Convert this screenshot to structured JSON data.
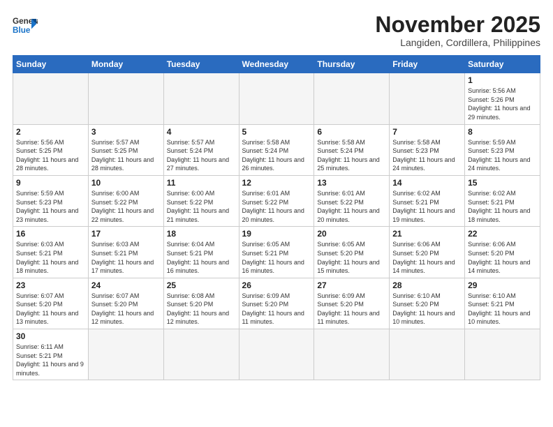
{
  "header": {
    "logo_line1": "General",
    "logo_line2": "Blue",
    "month_title": "November 2025",
    "subtitle": "Langiden, Cordillera, Philippines"
  },
  "weekdays": [
    "Sunday",
    "Monday",
    "Tuesday",
    "Wednesday",
    "Thursday",
    "Friday",
    "Saturday"
  ],
  "weeks": [
    [
      {
        "day": "",
        "info": ""
      },
      {
        "day": "",
        "info": ""
      },
      {
        "day": "",
        "info": ""
      },
      {
        "day": "",
        "info": ""
      },
      {
        "day": "",
        "info": ""
      },
      {
        "day": "",
        "info": ""
      },
      {
        "day": "1",
        "info": "Sunrise: 5:56 AM\nSunset: 5:26 PM\nDaylight: 11 hours and 29 minutes."
      }
    ],
    [
      {
        "day": "2",
        "info": "Sunrise: 5:56 AM\nSunset: 5:25 PM\nDaylight: 11 hours and 28 minutes."
      },
      {
        "day": "3",
        "info": "Sunrise: 5:57 AM\nSunset: 5:25 PM\nDaylight: 11 hours and 28 minutes."
      },
      {
        "day": "4",
        "info": "Sunrise: 5:57 AM\nSunset: 5:24 PM\nDaylight: 11 hours and 27 minutes."
      },
      {
        "day": "5",
        "info": "Sunrise: 5:58 AM\nSunset: 5:24 PM\nDaylight: 11 hours and 26 minutes."
      },
      {
        "day": "6",
        "info": "Sunrise: 5:58 AM\nSunset: 5:24 PM\nDaylight: 11 hours and 25 minutes."
      },
      {
        "day": "7",
        "info": "Sunrise: 5:58 AM\nSunset: 5:23 PM\nDaylight: 11 hours and 24 minutes."
      },
      {
        "day": "8",
        "info": "Sunrise: 5:59 AM\nSunset: 5:23 PM\nDaylight: 11 hours and 24 minutes."
      }
    ],
    [
      {
        "day": "9",
        "info": "Sunrise: 5:59 AM\nSunset: 5:23 PM\nDaylight: 11 hours and 23 minutes."
      },
      {
        "day": "10",
        "info": "Sunrise: 6:00 AM\nSunset: 5:22 PM\nDaylight: 11 hours and 22 minutes."
      },
      {
        "day": "11",
        "info": "Sunrise: 6:00 AM\nSunset: 5:22 PM\nDaylight: 11 hours and 21 minutes."
      },
      {
        "day": "12",
        "info": "Sunrise: 6:01 AM\nSunset: 5:22 PM\nDaylight: 11 hours and 20 minutes."
      },
      {
        "day": "13",
        "info": "Sunrise: 6:01 AM\nSunset: 5:22 PM\nDaylight: 11 hours and 20 minutes."
      },
      {
        "day": "14",
        "info": "Sunrise: 6:02 AM\nSunset: 5:21 PM\nDaylight: 11 hours and 19 minutes."
      },
      {
        "day": "15",
        "info": "Sunrise: 6:02 AM\nSunset: 5:21 PM\nDaylight: 11 hours and 18 minutes."
      }
    ],
    [
      {
        "day": "16",
        "info": "Sunrise: 6:03 AM\nSunset: 5:21 PM\nDaylight: 11 hours and 18 minutes."
      },
      {
        "day": "17",
        "info": "Sunrise: 6:03 AM\nSunset: 5:21 PM\nDaylight: 11 hours and 17 minutes."
      },
      {
        "day": "18",
        "info": "Sunrise: 6:04 AM\nSunset: 5:21 PM\nDaylight: 11 hours and 16 minutes."
      },
      {
        "day": "19",
        "info": "Sunrise: 6:05 AM\nSunset: 5:21 PM\nDaylight: 11 hours and 16 minutes."
      },
      {
        "day": "20",
        "info": "Sunrise: 6:05 AM\nSunset: 5:20 PM\nDaylight: 11 hours and 15 minutes."
      },
      {
        "day": "21",
        "info": "Sunrise: 6:06 AM\nSunset: 5:20 PM\nDaylight: 11 hours and 14 minutes."
      },
      {
        "day": "22",
        "info": "Sunrise: 6:06 AM\nSunset: 5:20 PM\nDaylight: 11 hours and 14 minutes."
      }
    ],
    [
      {
        "day": "23",
        "info": "Sunrise: 6:07 AM\nSunset: 5:20 PM\nDaylight: 11 hours and 13 minutes."
      },
      {
        "day": "24",
        "info": "Sunrise: 6:07 AM\nSunset: 5:20 PM\nDaylight: 11 hours and 12 minutes."
      },
      {
        "day": "25",
        "info": "Sunrise: 6:08 AM\nSunset: 5:20 PM\nDaylight: 11 hours and 12 minutes."
      },
      {
        "day": "26",
        "info": "Sunrise: 6:09 AM\nSunset: 5:20 PM\nDaylight: 11 hours and 11 minutes."
      },
      {
        "day": "27",
        "info": "Sunrise: 6:09 AM\nSunset: 5:20 PM\nDaylight: 11 hours and 11 minutes."
      },
      {
        "day": "28",
        "info": "Sunrise: 6:10 AM\nSunset: 5:20 PM\nDaylight: 11 hours and 10 minutes."
      },
      {
        "day": "29",
        "info": "Sunrise: 6:10 AM\nSunset: 5:21 PM\nDaylight: 11 hours and 10 minutes."
      }
    ],
    [
      {
        "day": "30",
        "info": "Sunrise: 6:11 AM\nSunset: 5:21 PM\nDaylight: 11 hours and 9 minutes."
      },
      {
        "day": "",
        "info": ""
      },
      {
        "day": "",
        "info": ""
      },
      {
        "day": "",
        "info": ""
      },
      {
        "day": "",
        "info": ""
      },
      {
        "day": "",
        "info": ""
      },
      {
        "day": "",
        "info": ""
      }
    ]
  ]
}
